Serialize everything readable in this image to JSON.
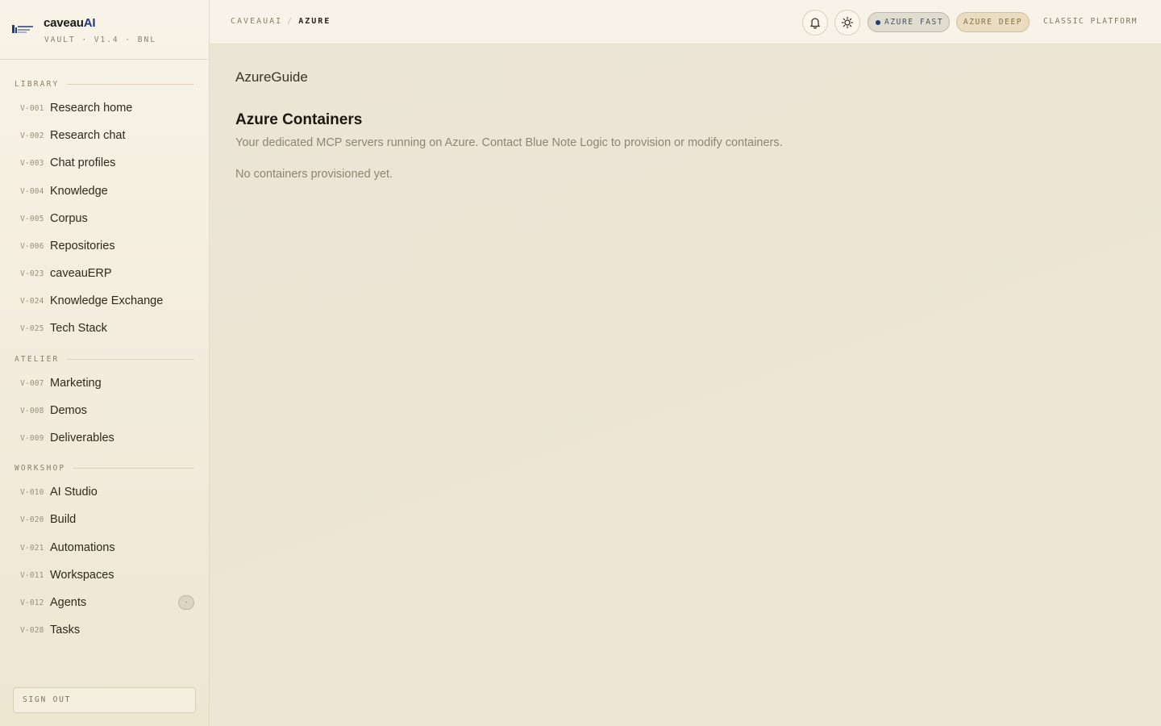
{
  "brand": {
    "name": "caveau",
    "name_accent": "AI",
    "subtitle": "VAULT · V1.4 · BNL"
  },
  "sidebar": {
    "sections": [
      {
        "title": "LIBRARY",
        "items": [
          {
            "code": "V-001",
            "label": "Research home"
          },
          {
            "code": "V-002",
            "label": "Research chat"
          },
          {
            "code": "V-003",
            "label": "Chat profiles"
          },
          {
            "code": "V-004",
            "label": "Knowledge"
          },
          {
            "code": "V-005",
            "label": "Corpus"
          },
          {
            "code": "V-006",
            "label": "Repositories"
          },
          {
            "code": "V-023",
            "label": "caveauERP"
          },
          {
            "code": "V-024",
            "label": "Knowledge Exchange"
          },
          {
            "code": "V-025",
            "label": "Tech Stack"
          }
        ]
      },
      {
        "title": "ATELIER",
        "items": [
          {
            "code": "V-007",
            "label": "Marketing"
          },
          {
            "code": "V-008",
            "label": "Demos"
          },
          {
            "code": "V-009",
            "label": "Deliverables"
          }
        ]
      },
      {
        "title": "WORKSHOP",
        "items": [
          {
            "code": "V-010",
            "label": "AI Studio"
          },
          {
            "code": "V-020",
            "label": "Build"
          },
          {
            "code": "V-021",
            "label": "Automations"
          },
          {
            "code": "V-011",
            "label": "Workspaces"
          },
          {
            "code": "V-012",
            "label": "Agents",
            "badge": "·"
          },
          {
            "code": "V-028",
            "label": "Tasks"
          }
        ]
      }
    ],
    "sign_out": "SIGN OUT"
  },
  "topbar": {
    "breadcrumb": [
      "CAVEAUAI",
      "AZURE"
    ],
    "breadcrumb_sep": "/",
    "icons": [
      "bell-icon",
      "sun-icon"
    ],
    "pill_fast": "AZURE FAST",
    "pill_deep": "AZURE DEEP",
    "classic": "CLASSIC PLATFORM"
  },
  "main": {
    "app_title": "AzureGuide",
    "title": "Azure Containers",
    "description": "Your dedicated MCP servers running on Azure. Contact Blue Note Logic to provision or modify containers.",
    "empty_state": "No containers provisioned yet."
  },
  "colors": {
    "accent": "#1d3a78",
    "background": "#efe8d7",
    "sidebar": "#f8f3e8"
  }
}
